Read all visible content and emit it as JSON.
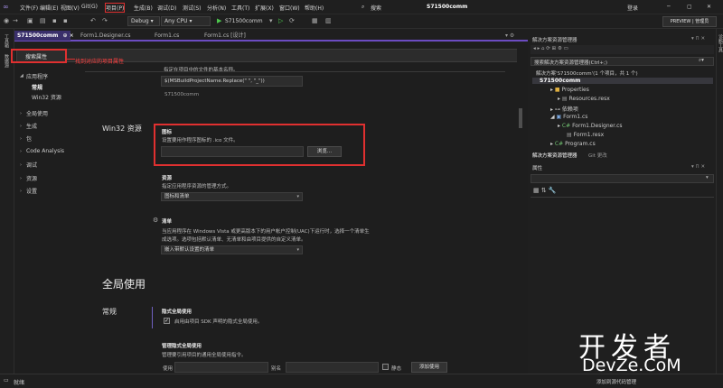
{
  "menubar": {
    "items": [
      "文件(F)",
      "编辑(E)",
      "视图(V)",
      "Git(G)",
      "项目(P)",
      "生成(B)",
      "调试(D)",
      "测试(S)",
      "分析(N)",
      "工具(T)",
      "扩展(X)",
      "窗口(W)",
      "帮助(H)"
    ],
    "search_label": "搜索",
    "solution_title": "S71500comm",
    "login_label": "登录"
  },
  "toolbar": {
    "config": "Debug",
    "platform": "Any CPU",
    "run_target": "S71500comm",
    "preview_label": "PREVIEW | 管理员"
  },
  "left_strip": {
    "items": [
      "工具箱",
      "数据源"
    ]
  },
  "tabs": [
    {
      "label": "S71500comm",
      "pin": "⊕ ×"
    },
    {
      "label": "Form1.Designer.cs"
    },
    {
      "label": "Form1.cs"
    },
    {
      "label": "Form1.cs [设计]"
    }
  ],
  "search": {
    "placeholder": "搜索属性"
  },
  "annotation": {
    "text": "找到对应的项目属性"
  },
  "nav": {
    "app_group": "应用程序",
    "app_general": "常规",
    "app_win32": "Win32 资源",
    "items": [
      "全局使用",
      "生成",
      "包",
      "Code Analysis",
      "调试",
      "资源",
      "设置"
    ]
  },
  "top_section": {
    "desc": "指定在项目中的文件的基本名称。",
    "value1": "$(MSBuildProjectName.Replace(\" \", \"_\"))",
    "value2": "S71500comm"
  },
  "win32": {
    "title": "Win32 资源",
    "icon_label": "图标",
    "icon_desc": "设置要用作程序图标的 .ico 文件。",
    "browse_label": "浏览...",
    "resources_label": "资源",
    "resources_desc": "指定应用程序资源的管理方式。",
    "resources_value": "图标和清单",
    "manifest_label": "清单",
    "manifest_desc1": "当应用程序在 Windows Vista 或更高版本下的用户帐户控制(UAC)下运行时，选择一个清单生",
    "manifest_desc2": "成选项。选项包括默认清单、无清单和由项目提供的自定义清单。",
    "manifest_value": "嵌入带默认设置的清单"
  },
  "global_usings": {
    "title": "全局使用",
    "general_label": "常规",
    "implicit_label": "隐式全局使用",
    "implicit_check": "启用由项目 SDK 声明的隐式全局使用。",
    "manage_label": "管理隐式全局使用",
    "manage_desc": "管理要引用项目的通用全局使用指令。",
    "using_label": "使用",
    "alias_label": "别名",
    "static_label": "静态",
    "add_label": "添加使用"
  },
  "solution_explorer": {
    "title": "解决方案资源管理器",
    "search_placeholder": "搜索解决方案资源管理器(Ctrl+;)",
    "solution_line": "解决方案'S71500comm'(1 个项目，共 1 个)",
    "project": "S71500comm",
    "items": [
      "Properties",
      "Resources.resx",
      "依赖项",
      "Form1.cs",
      "Form1.Designer.cs",
      "Form1.resx",
      "Program.cs"
    ],
    "tab1": "解决方案资源管理器",
    "tab2": "Git 更改"
  },
  "properties_panel": {
    "title": "属性"
  },
  "statusbar": {
    "ready": "就绪",
    "right_text": "添加到源代码管理"
  },
  "watermark": {
    "line1": "开发者",
    "line2": "DevZe.CoM"
  }
}
